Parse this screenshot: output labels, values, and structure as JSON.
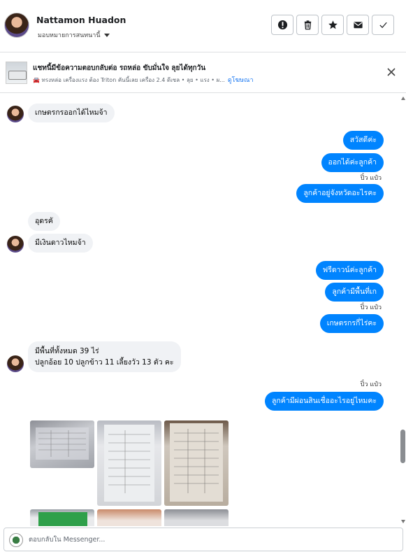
{
  "header": {
    "contact_name": "Nattamon Huadon",
    "assign_label": "มอบหมายการสนทนานี้",
    "actions": [
      "mark-spam-icon",
      "trash-icon",
      "star-icon",
      "envelope-icon",
      "check-icon"
    ]
  },
  "ad": {
    "title": "แชทนี้มีข้อความตอบกลับต่อ รถหล่อ ขับมั่นใจ ลุยได้ทุกวัน",
    "subtitle": "🚘 ทรงหล่อ เครื่องแรง ต้อง Triton คันนี้เลย เครื่อง 2.4 ดีเซล • ลุย • แรง • ผ...",
    "link": "ดูโฆษณา"
  },
  "messages": {
    "m1": "เกษตรกรออกได้ไหมจ้า",
    "m2": "สวัสดีค่ะ",
    "m3": "ออกได้ค่ะลูกค้า",
    "seen1": "ปิ๋ว แป๋ว",
    "m4": "ลูกค้าอยู่จังหวัดอะไรคะ",
    "m5": "อุดรคั",
    "m6": "มีเงินดาวไหมจ้า",
    "m7": "ฟรีดาวน์ค่ะลูกค้า",
    "m8": "ลูกค้ามีพื้นที่เก",
    "seen2": "ปิ๋ว แป๋ว",
    "m9": "เกษตรกรกี่ไร่คะ",
    "m10_line1": "มีพื้นที่ทั้งหมด 39 ไร่",
    "m10_line2": "ปลูกอ้อย 10 ปลูกข้าว 11 เลี้ยงวัว 13 ตัว คะ",
    "seen3": "ปิ๋ว แป๋ว",
    "m11": "ลูกค้ามีผ่อนสินเชื่ออะไรอยู่ไหมคะ"
  },
  "composer": {
    "placeholder": "ตอบกลับใน Messenger..."
  },
  "colors": {
    "outgoing_bubble": "#0084ff",
    "incoming_bubble": "#f0f2f5",
    "link": "#1877f2"
  }
}
